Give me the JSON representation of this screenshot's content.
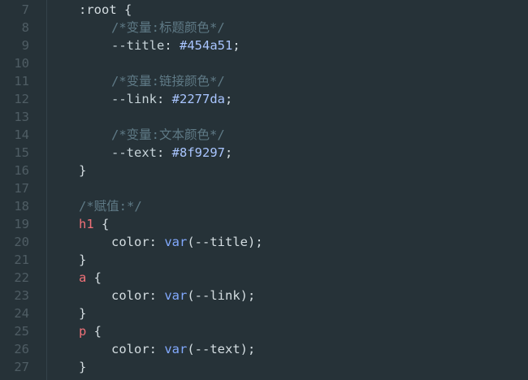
{
  "lines": [
    {
      "n": "7",
      "indent": 0,
      "tokens": [
        {
          "t": ":root ",
          "c": "t-plain"
        },
        {
          "t": "{",
          "c": "t-punc"
        }
      ]
    },
    {
      "n": "8",
      "indent": 1,
      "tokens": [
        {
          "t": "/*变量:标题颜色*/",
          "c": "t-comment"
        }
      ]
    },
    {
      "n": "9",
      "indent": 1,
      "tokens": [
        {
          "t": "--title",
          "c": "t-var"
        },
        {
          "t": ": ",
          "c": "t-punc"
        },
        {
          "t": "#454a51",
          "c": "t-val"
        },
        {
          "t": ";",
          "c": "t-punc"
        }
      ]
    },
    {
      "n": "10",
      "indent": 0,
      "tokens": []
    },
    {
      "n": "11",
      "indent": 1,
      "tokens": [
        {
          "t": "/*变量:链接颜色*/",
          "c": "t-comment"
        }
      ]
    },
    {
      "n": "12",
      "indent": 1,
      "tokens": [
        {
          "t": "--link",
          "c": "t-var"
        },
        {
          "t": ": ",
          "c": "t-punc"
        },
        {
          "t": "#2277da",
          "c": "t-val"
        },
        {
          "t": ";",
          "c": "t-punc"
        }
      ]
    },
    {
      "n": "13",
      "indent": 0,
      "tokens": []
    },
    {
      "n": "14",
      "indent": 1,
      "tokens": [
        {
          "t": "/*变量:文本颜色*/",
          "c": "t-comment"
        }
      ]
    },
    {
      "n": "15",
      "indent": 1,
      "tokens": [
        {
          "t": "--text",
          "c": "t-var"
        },
        {
          "t": ": ",
          "c": "t-punc"
        },
        {
          "t": "#8f9297",
          "c": "t-val"
        },
        {
          "t": ";",
          "c": "t-punc"
        }
      ]
    },
    {
      "n": "16",
      "indent": 0,
      "tokens": [
        {
          "t": "}",
          "c": "t-punc"
        }
      ]
    },
    {
      "n": "17",
      "indent": 0,
      "tokens": []
    },
    {
      "n": "18",
      "indent": 0,
      "tokens": [
        {
          "t": "/*赋值:*/",
          "c": "t-comment"
        }
      ]
    },
    {
      "n": "19",
      "indent": 0,
      "tokens": [
        {
          "t": "h1",
          "c": "t-tag"
        },
        {
          "t": " {",
          "c": "t-punc"
        }
      ]
    },
    {
      "n": "20",
      "indent": 1,
      "tokens": [
        {
          "t": "color",
          "c": "t-plain"
        },
        {
          "t": ": ",
          "c": "t-punc"
        },
        {
          "t": "var",
          "c": "t-fn"
        },
        {
          "t": "(--title);",
          "c": "t-punc"
        }
      ]
    },
    {
      "n": "21",
      "indent": 0,
      "tokens": [
        {
          "t": "}",
          "c": "t-punc"
        }
      ]
    },
    {
      "n": "22",
      "indent": 0,
      "tokens": [
        {
          "t": "a",
          "c": "t-tag"
        },
        {
          "t": " {",
          "c": "t-punc"
        }
      ]
    },
    {
      "n": "23",
      "indent": 1,
      "tokens": [
        {
          "t": "color",
          "c": "t-plain"
        },
        {
          "t": ": ",
          "c": "t-punc"
        },
        {
          "t": "var",
          "c": "t-fn"
        },
        {
          "t": "(--link);",
          "c": "t-punc"
        }
      ]
    },
    {
      "n": "24",
      "indent": 0,
      "tokens": [
        {
          "t": "}",
          "c": "t-punc"
        }
      ]
    },
    {
      "n": "25",
      "indent": 0,
      "tokens": [
        {
          "t": "p",
          "c": "t-tag"
        },
        {
          "t": " {",
          "c": "t-punc"
        }
      ]
    },
    {
      "n": "26",
      "indent": 1,
      "tokens": [
        {
          "t": "color",
          "c": "t-plain"
        },
        {
          "t": ": ",
          "c": "t-punc"
        },
        {
          "t": "var",
          "c": "t-fn"
        },
        {
          "t": "(--text);",
          "c": "t-punc"
        }
      ]
    },
    {
      "n": "27",
      "indent": 0,
      "tokens": [
        {
          "t": "}",
          "c": "t-punc"
        }
      ]
    }
  ]
}
